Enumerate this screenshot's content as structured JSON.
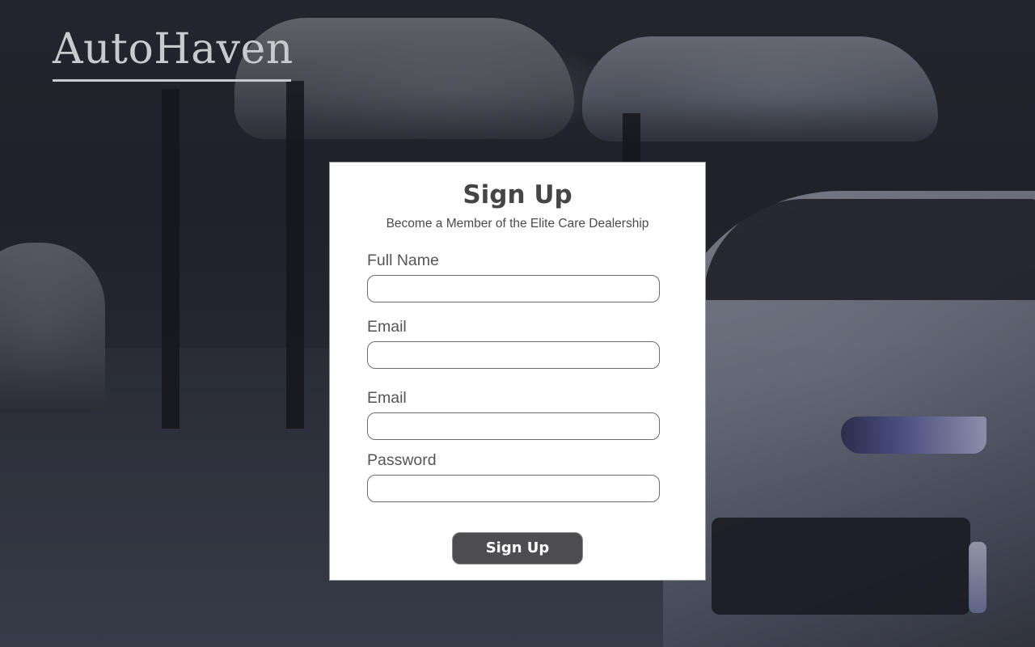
{
  "brand": {
    "logo_text": "AutoHaven"
  },
  "signup": {
    "title": "Sign Up",
    "subtitle": "Become a Member of the Elite Care Dealership",
    "fields": [
      {
        "label": "Full Name",
        "value": "",
        "placeholder": ""
      },
      {
        "label": "Email",
        "value": "",
        "placeholder": ""
      },
      {
        "label": "Email",
        "value": "",
        "placeholder": ""
      },
      {
        "label": "Password",
        "value": "",
        "placeholder": ""
      }
    ],
    "submit_label": "Sign Up"
  },
  "colors": {
    "card_background": "#ffffff",
    "button_background": "#4d4d4f",
    "text_dark": "#454545",
    "logo": "#c9cacd"
  }
}
